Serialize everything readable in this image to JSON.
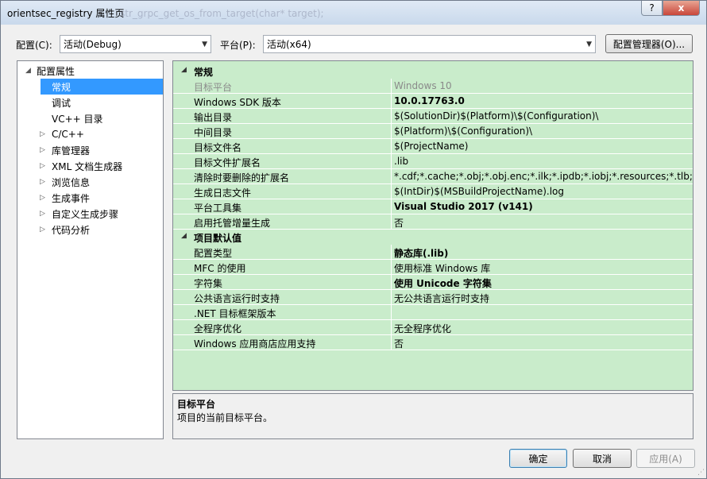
{
  "window": {
    "title": "orientsec_registry 属性页",
    "ghost_text": "str_grpc_get_os_from_target(char* target);",
    "help_glyph": "?",
    "close_glyph": "x"
  },
  "config_bar": {
    "config_label": "配置(C):",
    "config_value": "活动(Debug)",
    "platform_label": "平台(P):",
    "platform_value": "活动(x64)",
    "manager_button": "配置管理器(O)..."
  },
  "tree": {
    "root": "配置属性",
    "items": [
      {
        "label": "常规",
        "selected": true,
        "expandable": false
      },
      {
        "label": "调试",
        "selected": false,
        "expandable": false
      },
      {
        "label": "VC++ 目录",
        "selected": false,
        "expandable": false
      },
      {
        "label": "C/C++",
        "selected": false,
        "expandable": true
      },
      {
        "label": "库管理器",
        "selected": false,
        "expandable": true
      },
      {
        "label": "XML 文档生成器",
        "selected": false,
        "expandable": true
      },
      {
        "label": "浏览信息",
        "selected": false,
        "expandable": true
      },
      {
        "label": "生成事件",
        "selected": false,
        "expandable": true
      },
      {
        "label": "自定义生成步骤",
        "selected": false,
        "expandable": true
      },
      {
        "label": "代码分析",
        "selected": false,
        "expandable": true
      }
    ]
  },
  "grid": {
    "categories": [
      {
        "name": "常规",
        "rows": [
          {
            "name": "目标平台",
            "value": "Windows 10",
            "bold": false,
            "disabled": true
          },
          {
            "name": "Windows SDK 版本",
            "value": "10.0.17763.0",
            "bold": true,
            "disabled": false
          },
          {
            "name": "输出目录",
            "value": "$(SolutionDir)$(Platform)\\$(Configuration)\\",
            "bold": false,
            "disabled": false
          },
          {
            "name": "中间目录",
            "value": "$(Platform)\\$(Configuration)\\",
            "bold": false,
            "disabled": false
          },
          {
            "name": "目标文件名",
            "value": "$(ProjectName)",
            "bold": false,
            "disabled": false
          },
          {
            "name": "目标文件扩展名",
            "value": ".lib",
            "bold": false,
            "disabled": false
          },
          {
            "name": "清除时要删除的扩展名",
            "value": "*.cdf;*.cache;*.obj;*.obj.enc;*.ilk;*.ipdb;*.iobj;*.resources;*.tlb;*.tli;*.t",
            "bold": false,
            "disabled": false
          },
          {
            "name": "生成日志文件",
            "value": "$(IntDir)$(MSBuildProjectName).log",
            "bold": false,
            "disabled": false
          },
          {
            "name": "平台工具集",
            "value": "Visual Studio 2017 (v141)",
            "bold": true,
            "disabled": false
          },
          {
            "name": "启用托管增量生成",
            "value": "否",
            "bold": false,
            "disabled": false
          }
        ]
      },
      {
        "name": "项目默认值",
        "rows": [
          {
            "name": "配置类型",
            "value": "静态库(.lib)",
            "bold": true,
            "disabled": false
          },
          {
            "name": "MFC 的使用",
            "value": "使用标准 Windows 库",
            "bold": false,
            "disabled": false
          },
          {
            "name": "字符集",
            "value": "使用 Unicode 字符集",
            "bold": true,
            "disabled": false
          },
          {
            "name": "公共语言运行时支持",
            "value": "无公共语言运行时支持",
            "bold": false,
            "disabled": false
          },
          {
            "name": ".NET 目标框架版本",
            "value": "",
            "bold": false,
            "disabled": false
          },
          {
            "name": "全程序优化",
            "value": "无全程序优化",
            "bold": false,
            "disabled": false
          },
          {
            "name": "Windows 应用商店应用支持",
            "value": "否",
            "bold": false,
            "disabled": false
          }
        ]
      }
    ]
  },
  "description": {
    "title": "目标平台",
    "text": "项目的当前目标平台。"
  },
  "buttons": {
    "ok": "确定",
    "cancel": "取消",
    "apply": "应用(A)"
  },
  "colors": {
    "grid_background": "#c9eccb",
    "selection": "#3399ff"
  }
}
